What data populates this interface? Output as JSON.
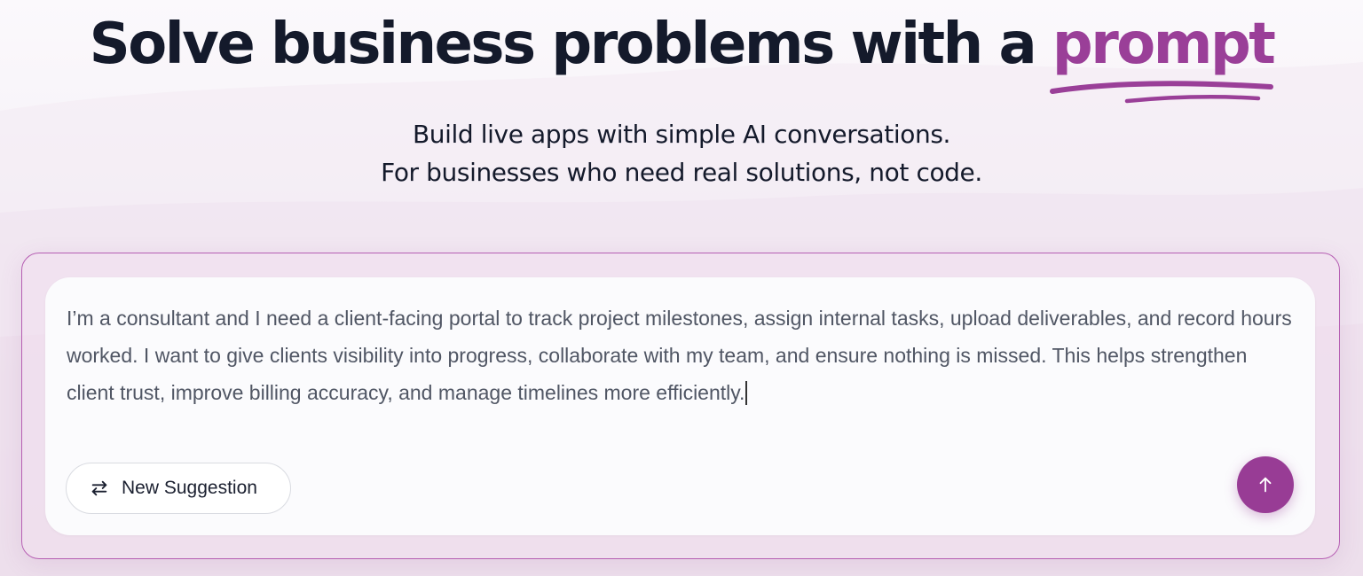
{
  "hero": {
    "title_prefix": "Solve business problems with a ",
    "title_accent": "prompt",
    "subtitle_line1": "Build live apps with simple AI conversations.",
    "subtitle_line2": "For businesses who need real solutions, not code."
  },
  "prompt_box": {
    "text": "I’m a consultant and I need a client-facing portal to track project milestones, assign internal tasks, upload deliverables, and record hours worked. I want to give clients visibility into progress, collaborate with my team, and ensure nothing is missed. This helps strengthen client trust, improve billing accuracy, and manage timelines more efficiently.",
    "suggestion_button_label": "New Suggestion",
    "suggestion_icon": "swap-arrows-icon",
    "send_icon": "arrow-up-icon"
  },
  "colors": {
    "accent": "#9a3f98",
    "title": "#141a2b",
    "send_button": "#983c95",
    "card_border": "#b65fb3"
  }
}
